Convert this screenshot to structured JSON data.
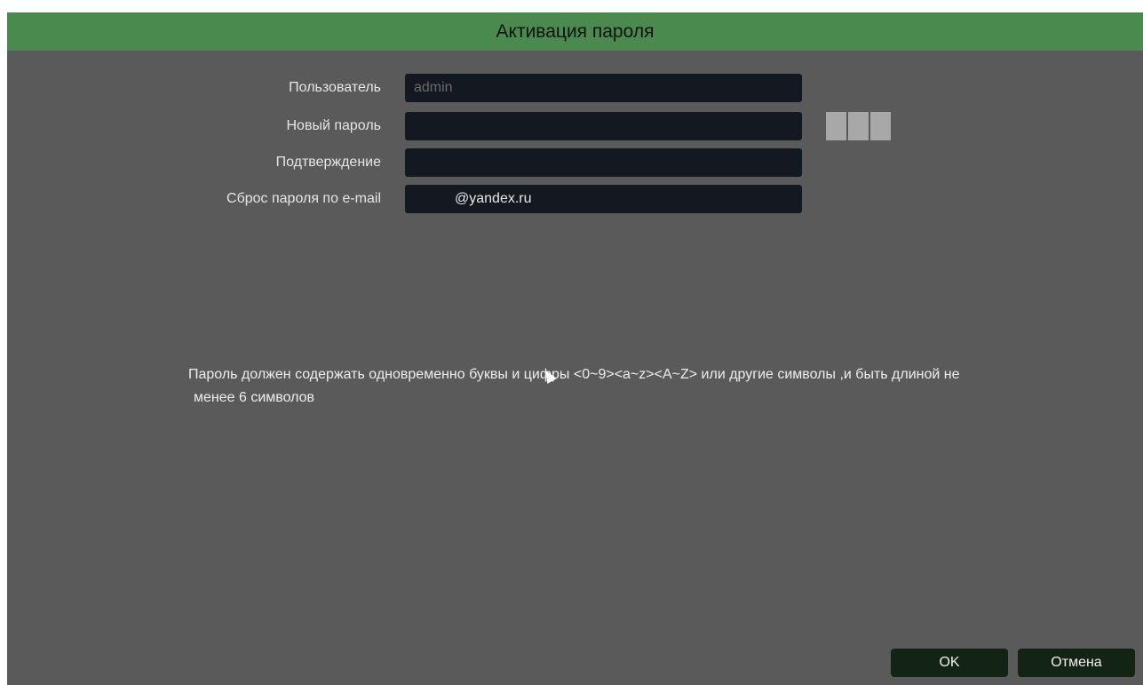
{
  "dialog": {
    "title": "Активация пароля"
  },
  "form": {
    "user_label": "Пользователь",
    "user_value": "admin",
    "new_password_label": "Новый пароль",
    "new_password_value": "",
    "confirm_label": "Подтверждение",
    "confirm_value": "",
    "email_reset_label": "Сброс пароля по e-mail",
    "email_value": "@yandex.ru"
  },
  "hint": {
    "line1": "Пароль должен содержать одновременно буквы и цифры <0~9><a~z><A~Z> или другие символы ,и быть длиной не",
    "line2": "менее 6 символов"
  },
  "buttons": {
    "ok_label": "OK",
    "cancel_label": "Отмена"
  },
  "colors": {
    "titlebar": "#4b8a4f",
    "background": "#5a5a5a",
    "field": "#141821",
    "button": "#142414"
  }
}
